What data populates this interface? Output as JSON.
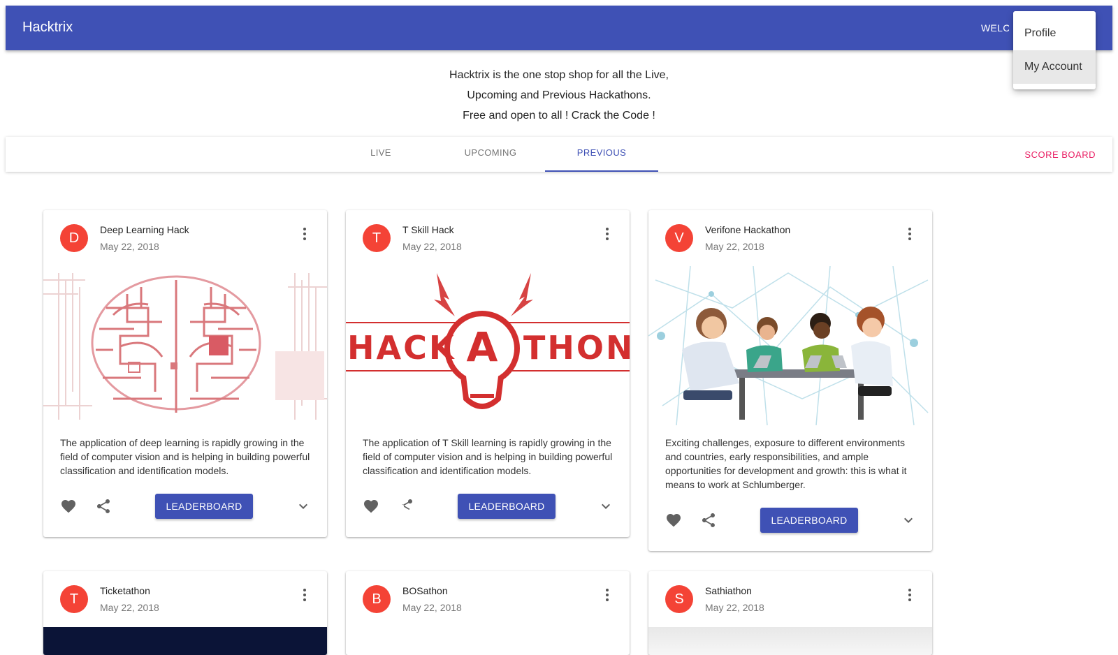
{
  "appbar": {
    "title": "Hacktrix",
    "welcome": "WELCOME"
  },
  "menu": {
    "items": [
      {
        "label": "Profile"
      },
      {
        "label": "My Account"
      }
    ]
  },
  "intro": {
    "line1": "Hacktrix is the one stop shop for all the Live,",
    "line2": "Upcoming and Previous Hackathons.",
    "line3": "Free and open to all ! Crack the Code !"
  },
  "tabs": [
    {
      "label": "LIVE"
    },
    {
      "label": "UPCOMING"
    },
    {
      "label": "PREVIOUS",
      "active": true
    }
  ],
  "score_board": "SCORE BOARD",
  "colors": {
    "primary": "#3f51b5",
    "avatar": "#f44336",
    "accent": "#e91e63"
  },
  "cards": [
    {
      "avatar": "D",
      "title": "Deep Learning Hack",
      "date": "May 22, 2018",
      "image": "circuit-brain-illustration",
      "description": "The application of deep learning is rapidly growing in the field of computer vision and is helping in building powerful classification and identification models.",
      "button": "LEADERBOARD"
    },
    {
      "avatar": "T",
      "title": "T Skill Hack",
      "date": "May 22, 2018",
      "image": "hackathon-lightbulb-logo",
      "image_text": [
        "HACK",
        "A",
        "THON"
      ],
      "description": "The application of T Skill learning is rapidly growing in the field of computer vision and is helping in building powerful classification and identification models.",
      "button": "LEADERBOARD"
    },
    {
      "avatar": "V",
      "title": "Verifone Hackathon",
      "date": "May 22, 2018",
      "image": "people-coding-at-table-illustration",
      "description": "Exciting challenges, exposure to different environments and countries, early responsibilities, and ample opportunities for development and growth: this is what it means to work at Schlumberger.",
      "button": "LEADERBOARD"
    },
    {
      "avatar": "T",
      "title": "Ticketathon",
      "date": "May 22, 2018"
    },
    {
      "avatar": "B",
      "title": "BOSathon",
      "date": "May 22, 2018"
    },
    {
      "avatar": "S",
      "title": "Sathiathon",
      "date": "May 22, 2018"
    }
  ]
}
